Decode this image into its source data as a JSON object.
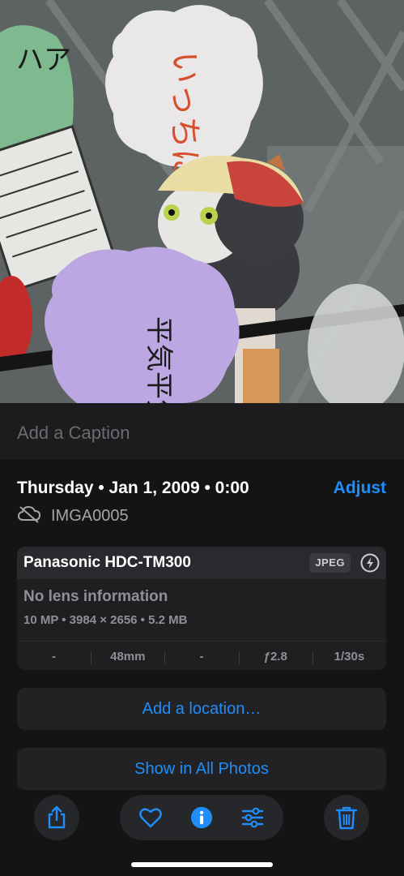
{
  "photo": {
    "bubble_top_text": "いっちに！",
    "bubble_left_text": "ハア",
    "bubble_bottom_text": "平気平気！"
  },
  "caption": {
    "placeholder": "Add a Caption"
  },
  "meta": {
    "date": "Thursday • Jan 1, 2009 • 0:00",
    "adjust_label": "Adjust",
    "filename": "IMGA0005"
  },
  "camera": {
    "name": "Panasonic HDC-TM300",
    "format": "JPEG",
    "lens": "No lens information",
    "specs": "10 MP • 3984 × 2656 • 5.2 MB",
    "exif": [
      "-",
      "48mm",
      "-",
      "ƒ2.8",
      "1/30s"
    ]
  },
  "actions": {
    "add_location": "Add a location…",
    "show_all": "Show in All Photos"
  },
  "colors": {
    "accent": "#1f8efa",
    "background": "#141414"
  }
}
